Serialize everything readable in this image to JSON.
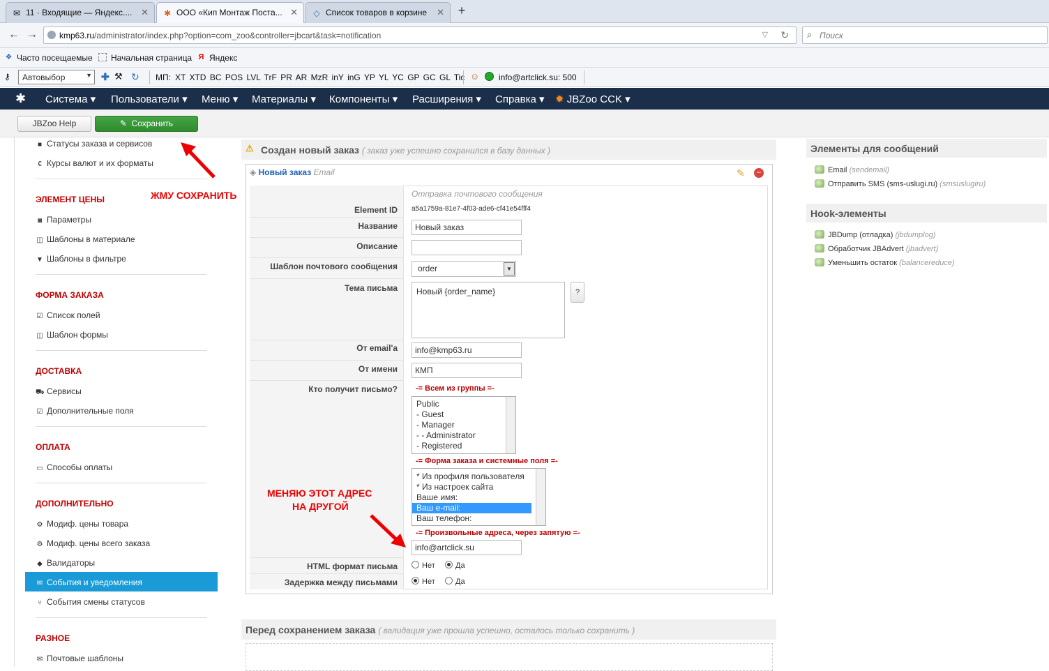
{
  "browser": {
    "tabs": [
      {
        "title": "11 · Входящие — Яндекс...."
      },
      {
        "title": "ООО «Кип Монтаж Поста..."
      },
      {
        "title": "Список товаров в корзине"
      }
    ],
    "new_tab": "+",
    "url_host": "kmp63.ru",
    "url_path": "/administrator/index.php?option=com_zoo&controller=jbcart&task=notification",
    "search_placeholder": "Поиск",
    "bookmarks": [
      "Часто посещаемые",
      "Начальная страница",
      "Яндекс"
    ],
    "toolbar_select": "Автовыбор",
    "mp_label": "МП:",
    "mp_items": [
      "XT",
      "XTD",
      "BC",
      "POS",
      "LVL",
      "TrF",
      "PR",
      "AR",
      "MzR",
      "inY",
      "inG",
      "YP",
      "YL",
      "YC",
      "GP",
      "GC",
      "GL",
      "Tic"
    ],
    "account": "info@artclick.su: 500"
  },
  "menu": {
    "items": [
      "Система",
      "Пользователи",
      "Меню",
      "Материалы",
      "Компоненты",
      "Расширения",
      "Справка",
      "JBZoo CCK"
    ]
  },
  "toolbar": {
    "help_label": "JBZoo Help",
    "save_label": "Сохранить"
  },
  "sidebar": {
    "top_items": [
      "Статусы заказа и сервисов",
      "Курсы валют и их форматы"
    ],
    "groups": [
      {
        "title": "ЭЛЕМЕНТ ЦЕНЫ",
        "items": [
          "Параметры",
          "Шаблоны в материале",
          "Шаблоны в фильтре"
        ]
      },
      {
        "title": "ФОРМА ЗАКАЗА",
        "items": [
          "Список полей",
          "Шаблон формы"
        ]
      },
      {
        "title": "ДОСТАВКА",
        "items": [
          "Сервисы",
          "Дополнительные поля"
        ]
      },
      {
        "title": "ОПЛАТА",
        "items": [
          "Способы оплаты"
        ]
      },
      {
        "title": "ДОПОЛНИТЕЛЬНО",
        "items": [
          "Модиф. цены товара",
          "Модиф. цены всего заказа",
          "Валидаторы",
          "События и уведомления",
          "События смены статусов"
        ]
      },
      {
        "title": "РАЗНОЕ",
        "items": [
          "Почтовые шаблоны"
        ]
      }
    ]
  },
  "main": {
    "event_title": "Создан новый заказ",
    "event_note": "( заказ уже успешно сохранился в базу данных )",
    "element_title": "Новый заказ",
    "element_type": "Email",
    "form_heading": "Отправка почтового сообщения",
    "labels": {
      "element_id": "Element ID",
      "name": "Название",
      "description": "Описание",
      "template": "Шаблон почтового сообщения",
      "subject": "Тема письма",
      "from_email": "От email'а",
      "from_name": "От имени",
      "recipients": "Кто получит письмо?",
      "html": "HTML формат письма",
      "delay": "Задержка между письмами"
    },
    "values": {
      "element_id": "a5a1759a-81e7-4f03-ade6-cf41e54fff4",
      "name": "Новый заказ",
      "description": "",
      "template": "order",
      "subject": "Новый {order_name}",
      "help": "?",
      "from_email": "info@kmp63.ru",
      "from_name": "КМП",
      "custom_addresses": "info@artclick.su"
    },
    "group_heading": "-= Всем из группы =-",
    "groups_list": [
      "Public",
      "- Guest",
      "- Manager",
      "- - Administrator",
      "- Registered"
    ],
    "order_heading": "-= Форма заказа и системные поля =-",
    "order_list": [
      "* Из профиля пользователя",
      "* Из настроек сайта",
      "Ваше имя:",
      "Ваш e-mail:",
      "Ваш телефон:"
    ],
    "order_selected": "Ваш e-mail:",
    "custom_heading": "-= Произвольные адреса, через запятую =-",
    "radio_no": "Нет",
    "radio_yes": "Да",
    "html_value": "Да",
    "delay_value": "Нет",
    "next_event_title": "Перед сохранением заказа",
    "next_event_note": "( валидация уже прошла успешно, осталось только сохранить )"
  },
  "annotations": {
    "save": "ЖМУ СОХРАНИТЬ",
    "change_line1": "МЕНЯЮ ЭТОТ АДРЕС",
    "change_line2": "НА ДРУГОЙ"
  },
  "rightbar": {
    "messages_title": "Элементы для сообщений",
    "messages": [
      {
        "name": "Email",
        "code": "(sendemail)"
      },
      {
        "name": "Отправить SMS (sms-uslugi.ru)",
        "code": "(smsuslugiru)"
      }
    ],
    "hooks_title": "Hook-элементы",
    "hooks": [
      {
        "name": "JBDump (отладка)",
        "code": "(jbdumplog)"
      },
      {
        "name": "Обработчик JBAdvert",
        "code": "(jbadvert)"
      },
      {
        "name": "Уменьшить остаток",
        "code": "(balancereduce)"
      }
    ]
  },
  "colors": {
    "menu_bg": "#1b2f4a",
    "save_green": "#3a9a3a",
    "active_item": "#1a9bd7",
    "section_red": "#c00000",
    "annotation_red": "#e00000"
  }
}
